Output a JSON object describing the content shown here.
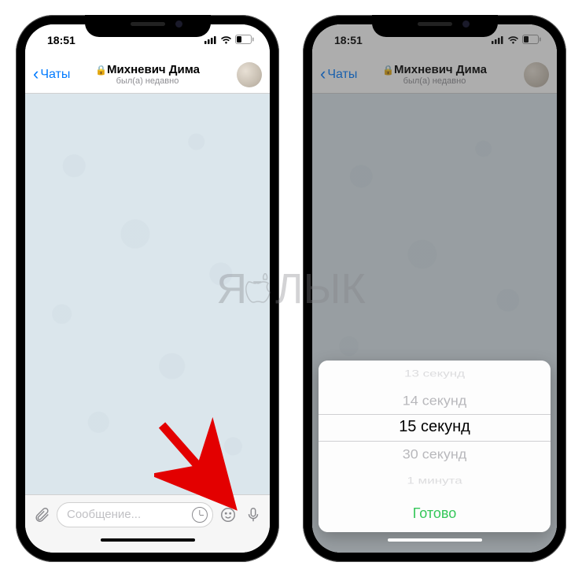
{
  "status": {
    "time": "18:51"
  },
  "header": {
    "back": "Чаты",
    "title": "Михневич Дима",
    "subtitle": "был(а) недавно"
  },
  "input": {
    "placeholder": "Сообщение..."
  },
  "picker": {
    "items": [
      "13 секунд",
      "14 секунд",
      "15 секунд",
      "30 секунд",
      "1 минута"
    ],
    "selected_index": 2,
    "done": "Готово"
  },
  "watermark": {
    "left": "Я",
    "right": "ЛЫК"
  }
}
